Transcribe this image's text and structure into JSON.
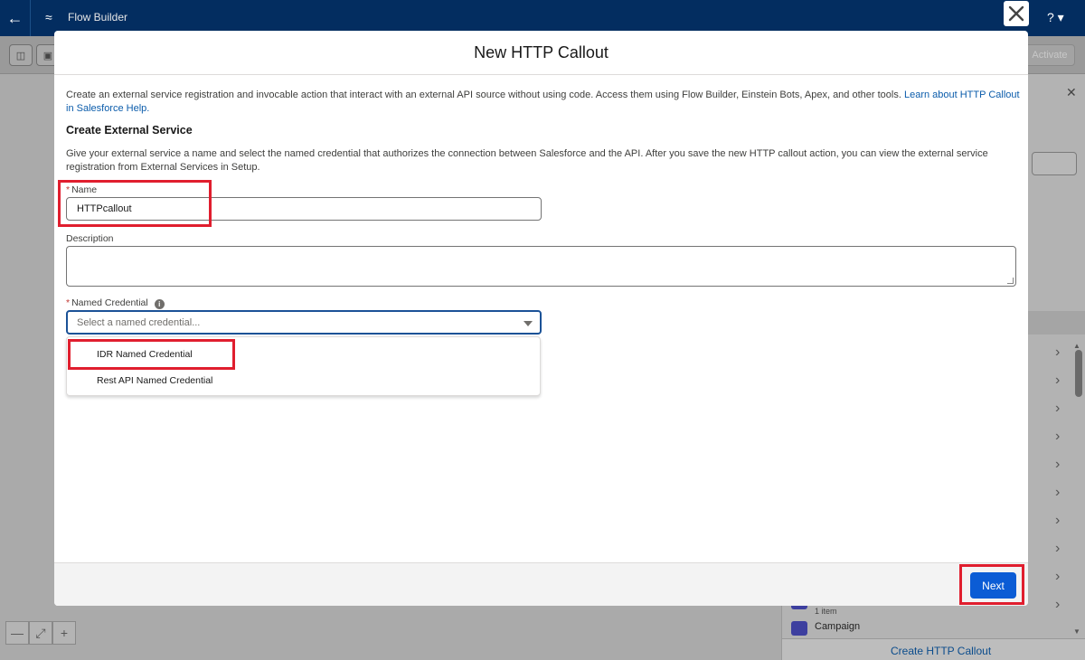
{
  "app": {
    "title": "Flow Builder",
    "activate_label": "Activate",
    "panel_item_count": "1 item",
    "panel_object_label": "Campaign",
    "panel_footer_link": "Create HTTP Callout"
  },
  "modal": {
    "title": "New HTTP Callout",
    "intro_text": "Create an external service registration and invocable action that interact with an external API source without using code. Access them using Flow Builder, Einstein Bots, Apex, and other tools. ",
    "intro_link": "Learn about HTTP Callout in Salesforce Help.",
    "section_title": "Create External Service",
    "section_desc": "Give your external service a name and select the named credential that authorizes the connection between Salesforce and the API. After you save the new HTTP callout action, you can view the external service registration from External Services in Setup.",
    "name_label": "Name",
    "name_value": "HTTPcallout",
    "description_label": "Description",
    "credential_label": "Named Credential",
    "credential_placeholder": "Select a named credential...",
    "options": [
      "IDR Named Credential",
      "Rest API Named Credential"
    ],
    "next_label": "Next"
  },
  "colors": {
    "brand_header": "#032d60",
    "primary_button": "#0b5cd5",
    "highlight": "#e01e2e",
    "link": "#0b5cab"
  },
  "icons": [
    "back-arrow-icon",
    "flow-icon",
    "help-icon",
    "close-icon",
    "info-icon",
    "chevron-down-icon",
    "chevron-right-icon",
    "zoom-out-icon",
    "fit-icon",
    "zoom-in-icon"
  ]
}
